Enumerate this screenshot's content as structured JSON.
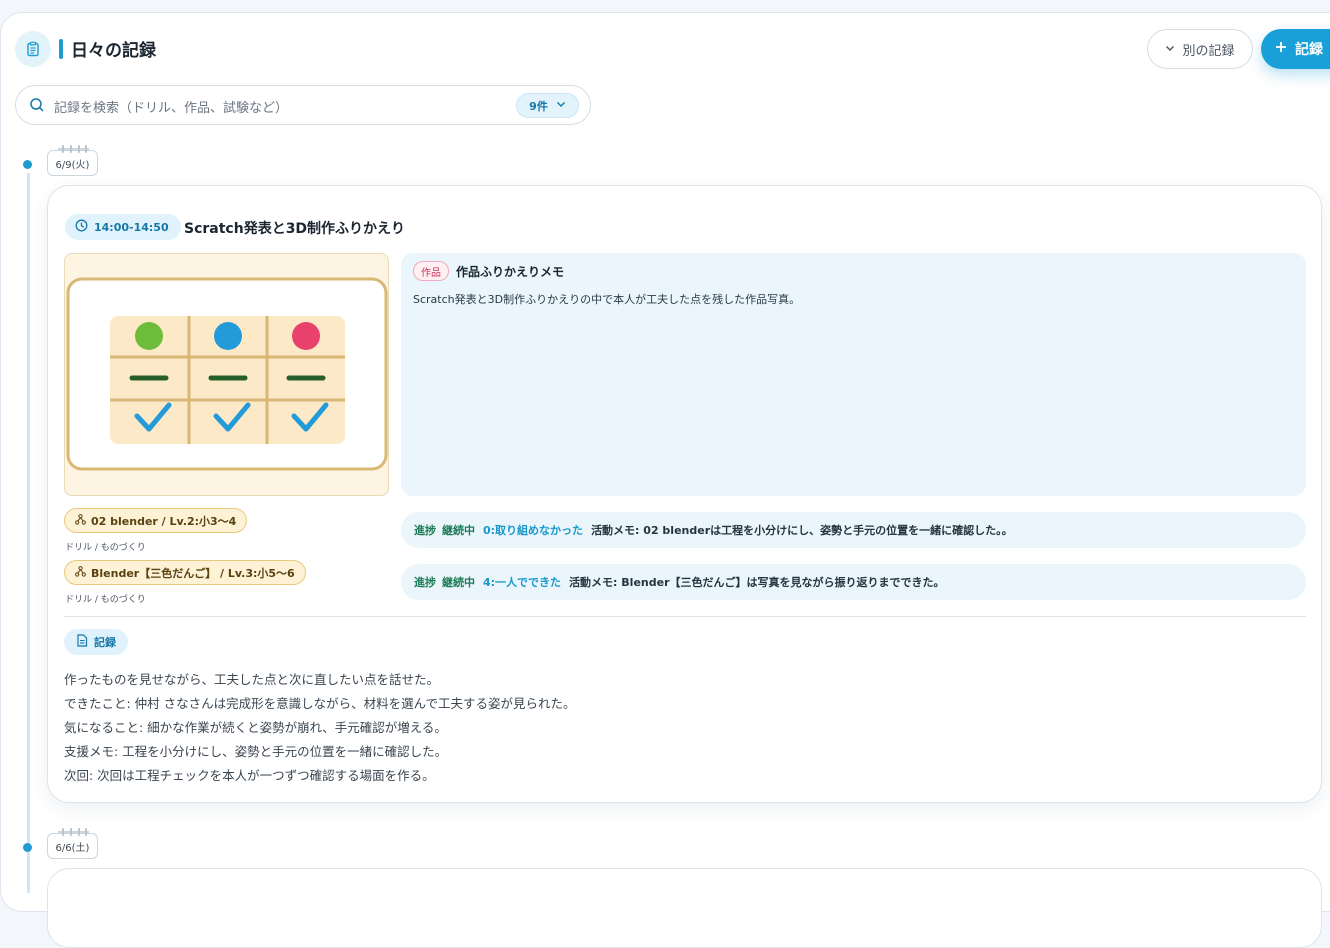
{
  "header": {
    "title": "日々の記録",
    "other_button": "別の記録",
    "add_button": "記録"
  },
  "search": {
    "placeholder": "記録を検索（ドリル、作品、試験など）",
    "count": "9件"
  },
  "entries": [
    {
      "date": "6/9(火)",
      "time": "14:00-14:50",
      "title": "Scratch発表と3D制作ふりかえり",
      "memo": {
        "tag": "作品",
        "title": "作品ふりかえりメモ",
        "body": "Scratch発表と3D制作ふりかえりの中で本人が工夫した点を残した作品写真。"
      },
      "skills": [
        {
          "name": "02 blender / Lv.2:小3〜4",
          "category": "ドリル / ものづくり"
        },
        {
          "name": "Blender【三色だんご】 / Lv.3:小5〜6",
          "category": "ドリル / ものづくり"
        }
      ],
      "progress": [
        {
          "label": "進捗",
          "status": "継続中",
          "level": "0:取り組めなかった",
          "note": "活動メモ: 02 blenderは工程を小分けにし、姿勢と手元の位置を一緒に確認した。。"
        },
        {
          "label": "進捗",
          "status": "継続中",
          "level": "4:一人でできた",
          "note": "活動メモ: Blender【三色だんご】は写真を見ながら振り返りまでできた。"
        }
      ],
      "record": {
        "label": "記録",
        "lines": [
          "作ったものを見せながら、工夫した点と次に直したい点を話せた。",
          "できたこと: 仲村 さなさんは完成形を意識しながら、材料を選んで工夫する姿が見られた。",
          "気になること: 細かな作業が続くと姿勢が崩れ、手元確認が増える。",
          "支援メモ: 工程を小分けにし、姿勢と手元の位置を一緒に確認した。",
          "次回: 次回は工程チェックを本人が一つずつ確認する場面を作る。"
        ]
      }
    },
    {
      "date": "6/6(土)"
    }
  ],
  "colors": {
    "accent": "#1aa0d8",
    "progress_green": "#1c7a55",
    "skill_bg": "#fdf1d6",
    "memo_bg": "#eaf5fc"
  }
}
